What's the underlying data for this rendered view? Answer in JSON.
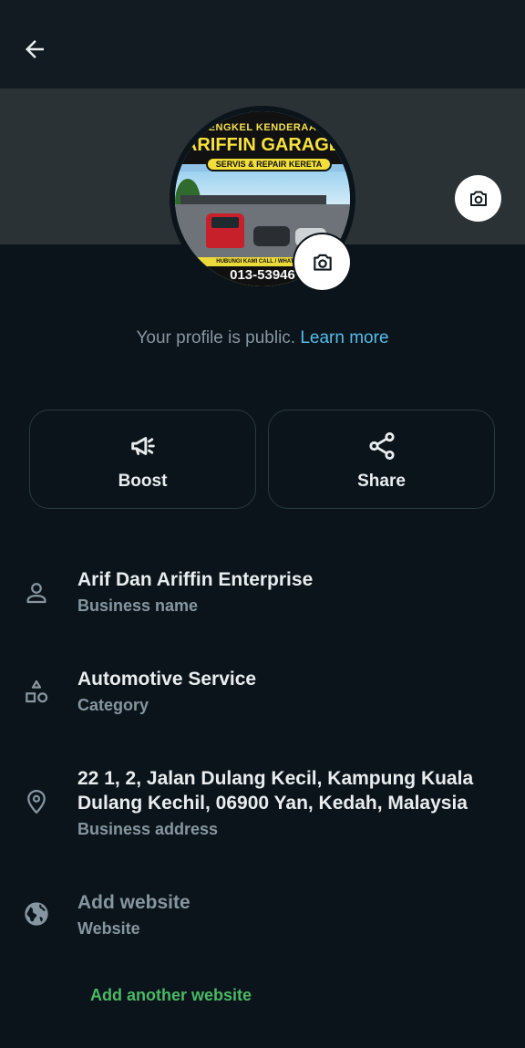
{
  "header": {
    "back_icon": "arrow-left-icon"
  },
  "cover": {
    "camera_icon": "camera-icon"
  },
  "avatar": {
    "line1": "BENGKEL KENDERAAN",
    "line2": "ARIFFIN GARAGE",
    "tagline": "SERVIS & REPAIR KERETA",
    "contact_label": "HUBUNGI KAMI CALL / WHATSAPP",
    "phone": "013-53946",
    "camera_icon": "camera-icon"
  },
  "public_note": {
    "text": "Your profile is public.",
    "link": "Learn more"
  },
  "actions": {
    "boost": {
      "label": "Boost",
      "icon": "megaphone-icon"
    },
    "share": {
      "label": "Share",
      "icon": "share-icon"
    }
  },
  "info": {
    "business_name": {
      "value": "Arif Dan Ariffin Enterprise",
      "label": "Business name",
      "icon": "person-icon"
    },
    "category": {
      "value": "Automotive Service",
      "label": "Category",
      "icon": "shapes-icon"
    },
    "address": {
      "value": "22 1, 2, Jalan Dulang Kecil, Kampung Kuala Dulang Kechil, 06900 Yan, Kedah, Malaysia",
      "label": "Business address",
      "icon": "location-pin-icon"
    },
    "website": {
      "value": "Add website",
      "label": "Website",
      "icon": "globe-icon"
    }
  },
  "add_another_website": "Add another website",
  "colors": {
    "background": "#0b141a",
    "header": "#111b21",
    "cover": "#2b3236",
    "link": "#53bdeb",
    "accent_green": "#4bb865",
    "muted": "#8696a0"
  }
}
